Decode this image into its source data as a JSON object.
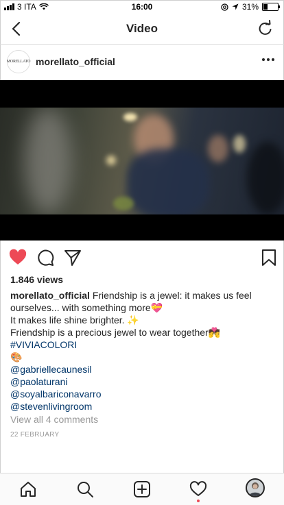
{
  "status": {
    "carrier": "3 ITA",
    "time": "16:00",
    "battery": "31%",
    "battery_level": 0.31
  },
  "header": {
    "title": "Video"
  },
  "post": {
    "author": "morellato_official",
    "avatar_text": "MORELLATO",
    "views": "1.846 views",
    "caption": {
      "username": "morellato_official",
      "text1": "Friendship is a jewel: it makes us feel ourselves... with something more💝",
      "text2": "It makes life shine brighter. ✨",
      "text3": "Friendship is a precious jewel to wear together💏",
      "hashtag": "#VIVIACOLORI",
      "emoji": "🎨",
      "mentions": [
        "@gabriellecaunesil",
        "@paolaturani",
        "@soyalbariconavarro",
        "@stevenlivingroom"
      ]
    },
    "comments_link": "View all 4 comments",
    "date": "22 FEBRUARY"
  },
  "colors": {
    "like": "#ed4956",
    "link": "#003569",
    "muted": "#999999"
  },
  "icons": {
    "header": [
      "back-icon",
      "refresh-icon"
    ],
    "actions": [
      "heart-icon",
      "comment-icon",
      "share-icon",
      "bookmark-icon"
    ],
    "tabs": [
      "home-icon",
      "search-icon",
      "add-icon",
      "activity-icon",
      "profile-icon"
    ]
  }
}
